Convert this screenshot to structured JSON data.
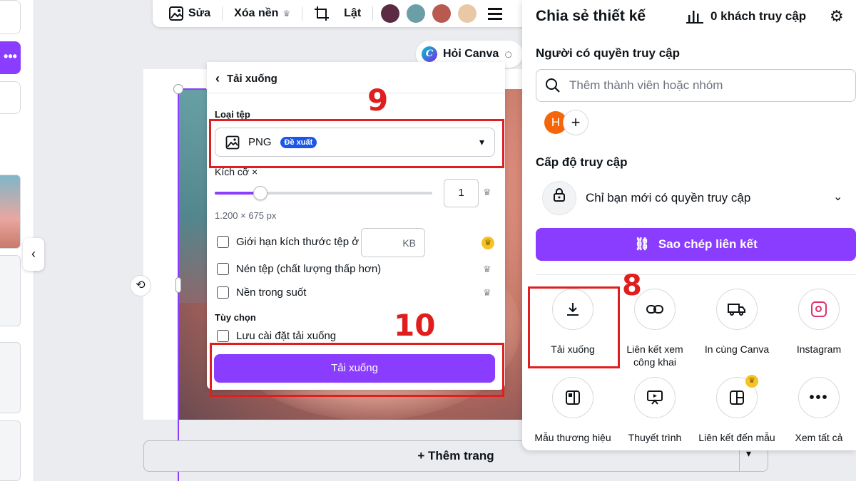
{
  "toolbar": {
    "edit_label": "Sửa",
    "bg_remove_label": "Xóa nền",
    "flip_label": "Lật",
    "swatches": [
      "#5b2b45",
      "#6b9ea6",
      "#b85a50",
      "#e9c9a5"
    ]
  },
  "ask_canva": "Hỏi Canva",
  "add_page": "+ Thêm trang",
  "download_panel": {
    "back_title": "Tải xuống",
    "file_type_label": "Loại tệp",
    "file_type_value": "PNG",
    "recommended_badge": "Đề xuất",
    "size_label": "Kích cỡ ×",
    "size_value": "1",
    "size_fraction": 0.2,
    "dimensions": "1.200 × 675 px",
    "limit_size_label": "Giới hạn kích thước tệp ở",
    "kb_unit": "KB",
    "compress_label": "Nén tệp (chất lượng thấp hơn)",
    "transparent_label": "Nền trong suốt",
    "options_label": "Tùy chọn",
    "save_settings_label": "Lưu cài đặt tải xuống",
    "download_button": "Tải xuống"
  },
  "annotations": {
    "step8": "8",
    "step9": "9",
    "step10": "10"
  },
  "share_panel": {
    "title": "Chia sẻ thiết kế",
    "visitors": "0 khách truy cập",
    "people_access_label": "Người có quyền truy cập",
    "search_placeholder": "Thêm thành viên hoặc nhóm",
    "avatar_initial": "H",
    "access_level_label": "Cấp độ truy cập",
    "access_value": "Chỉ bạn mới có quyền truy cập",
    "copy_link": "Sao chép liên kết",
    "options": [
      {
        "label": "Tải xuống",
        "icon": "download-icon"
      },
      {
        "label": "Liên kết xem công khai",
        "icon": "link-icon"
      },
      {
        "label": "In cùng Canva",
        "icon": "truck-icon"
      },
      {
        "label": "Instagram",
        "icon": "instagram-icon"
      },
      {
        "label": "Mẫu thương hiệu",
        "icon": "brand-template-icon"
      },
      {
        "label": "Thuyết trình",
        "icon": "presentation-icon"
      },
      {
        "label": "Liên kết đến mẫu",
        "icon": "template-link-icon"
      },
      {
        "label": "Xem tất cả",
        "icon": "more-icon"
      }
    ]
  }
}
